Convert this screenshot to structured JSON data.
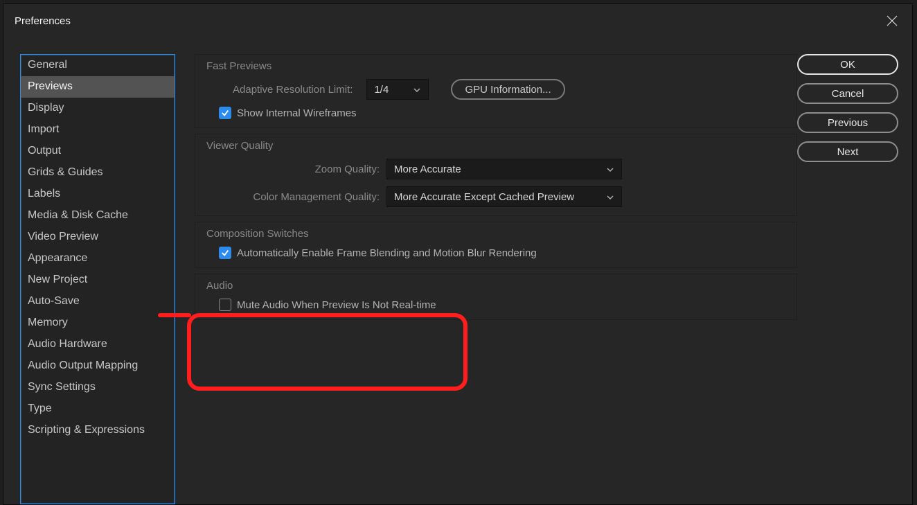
{
  "title": "Preferences",
  "sidebar": {
    "items": [
      {
        "label": "General"
      },
      {
        "label": "Previews",
        "selected": true
      },
      {
        "label": "Display"
      },
      {
        "label": "Import"
      },
      {
        "label": "Output"
      },
      {
        "label": "Grids & Guides"
      },
      {
        "label": "Labels"
      },
      {
        "label": "Media & Disk Cache"
      },
      {
        "label": "Video Preview"
      },
      {
        "label": "Appearance"
      },
      {
        "label": "New Project"
      },
      {
        "label": "Auto-Save"
      },
      {
        "label": "Memory"
      },
      {
        "label": "Audio Hardware"
      },
      {
        "label": "Audio Output Mapping"
      },
      {
        "label": "Sync Settings"
      },
      {
        "label": "Type"
      },
      {
        "label": "Scripting & Expressions"
      }
    ]
  },
  "buttons": {
    "ok": "OK",
    "cancel": "Cancel",
    "previous": "Previous",
    "next": "Next"
  },
  "sections": {
    "fastPreviews": {
      "title": "Fast Previews",
      "adaptiveLabel": "Adaptive Resolution Limit:",
      "adaptiveValue": "1/4",
      "gpuInfo": "GPU Information...",
      "showWireframes": "Show Internal Wireframes",
      "showWireframesChecked": true
    },
    "viewerQuality": {
      "title": "Viewer Quality",
      "zoomLabel": "Zoom Quality:",
      "zoomValue": "More Accurate",
      "cmLabel": "Color Management Quality:",
      "cmValue": "More Accurate Except Cached Preview"
    },
    "compositionSwitches": {
      "title": "Composition Switches",
      "autoFrameBlend": "Automatically Enable Frame Blending and Motion Blur Rendering",
      "autoFrameBlendChecked": true
    },
    "audio": {
      "title": "Audio",
      "muteRealtime": "Mute Audio When Preview Is Not Real-time",
      "muteRealtimeChecked": false
    }
  }
}
